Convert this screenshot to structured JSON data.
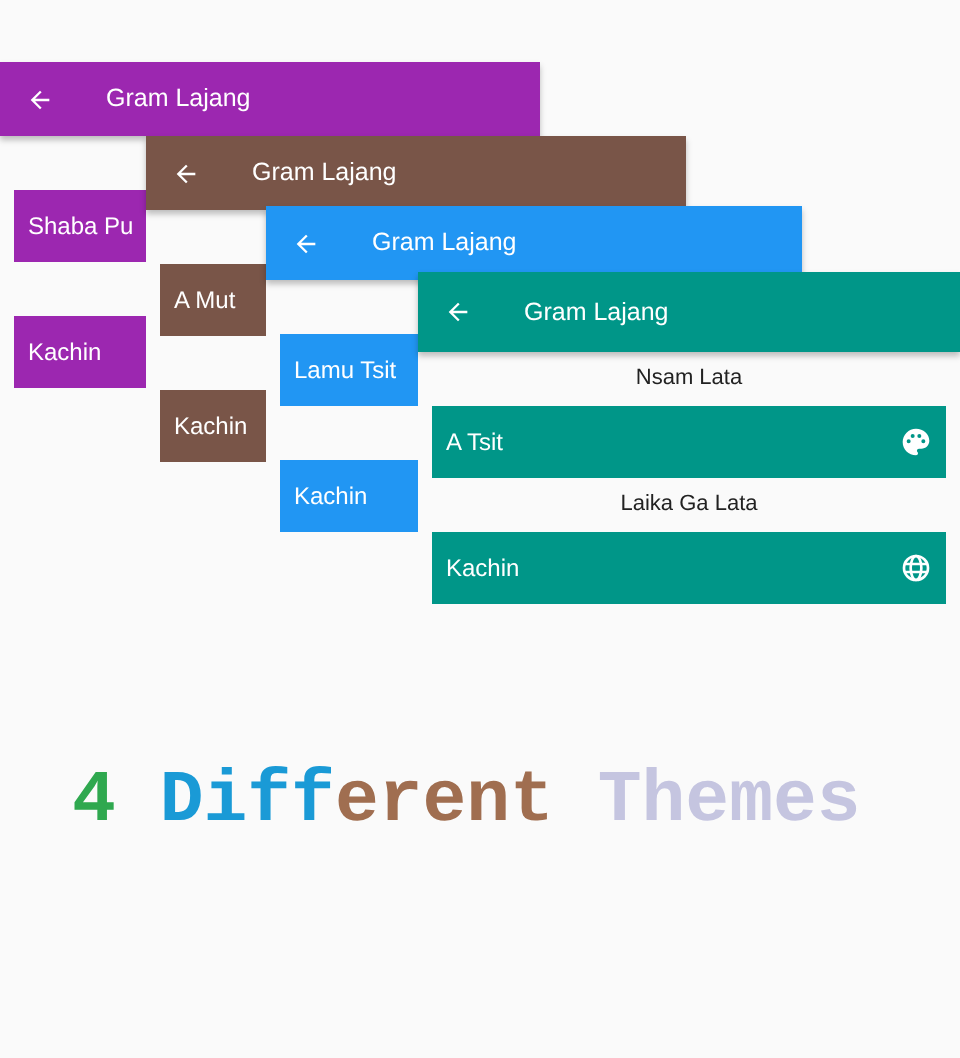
{
  "screens": [
    {
      "color": "#9c27b0",
      "title": "Gram Lajang",
      "items": [
        {
          "kind": "button",
          "label": "Shaba Pu"
        },
        {
          "kind": "button",
          "label": "Kachin"
        }
      ]
    },
    {
      "color": "#795548",
      "title": "Gram Lajang",
      "items": [
        {
          "kind": "button",
          "label": "A Mut"
        },
        {
          "kind": "button",
          "label": "Kachin"
        }
      ]
    },
    {
      "color": "#2196f3",
      "title": "Gram Lajang",
      "items": [
        {
          "kind": "button",
          "label": "Lamu Tsit"
        },
        {
          "kind": "button",
          "label": "Kachin"
        }
      ]
    },
    {
      "color": "#009688",
      "title": "Gram Lajang",
      "items": [
        {
          "kind": "label",
          "label": "Nsam Lata"
        },
        {
          "kind": "palette-button",
          "label": "A Tsit"
        },
        {
          "kind": "label",
          "label": "Laika Ga Lata"
        },
        {
          "kind": "globe-button",
          "label": "Kachin"
        }
      ]
    }
  ],
  "headline": [
    {
      "text": "4 ",
      "color": "#2fa84f"
    },
    {
      "text": "Diff",
      "color": "#1a9ad6"
    },
    {
      "text": "erent ",
      "color": "#a06e50"
    },
    {
      "text": "Themes",
      "color": "#c5c5e0"
    }
  ]
}
